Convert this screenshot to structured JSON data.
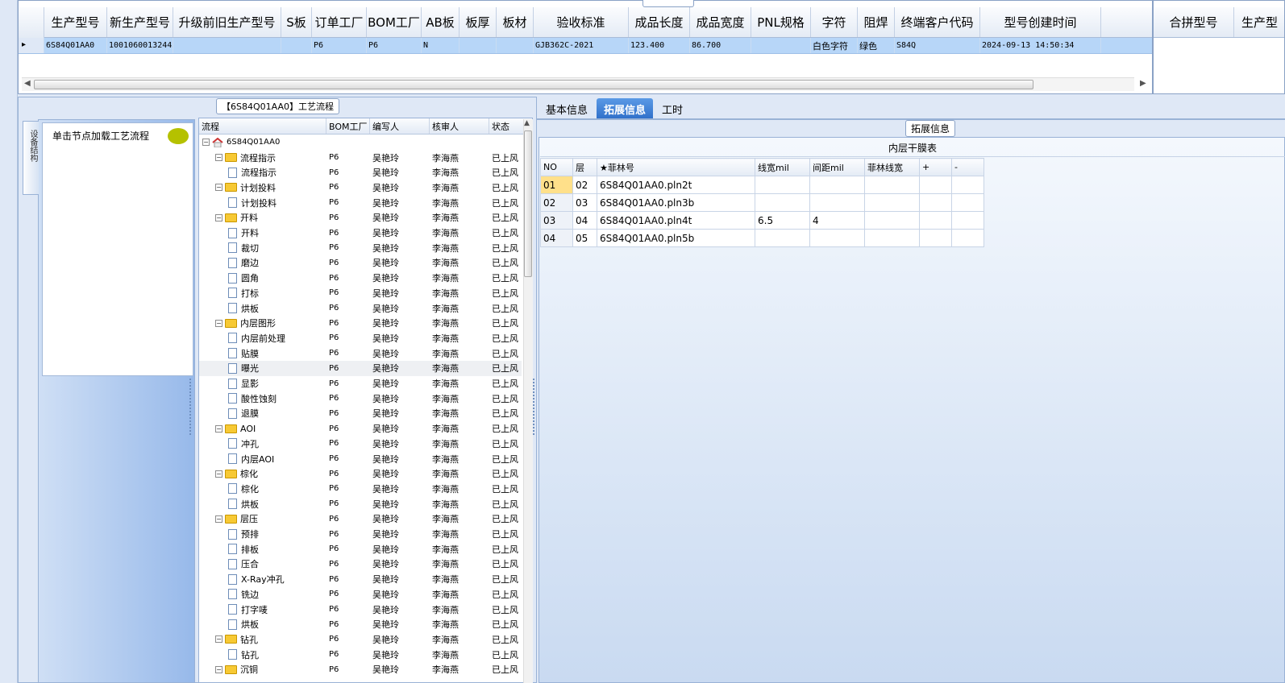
{
  "top_grid": {
    "columns": [
      "生产型号",
      "新生产型号",
      "升级前旧生产型号",
      "S板",
      "订单工厂",
      "BOM工厂",
      "AB板",
      "板厚",
      "板材",
      "验收标准",
      "成品长度",
      "成品宽度",
      "PNL规格",
      "字符",
      "阻焊",
      "终端客户代码",
      "型号创建时间"
    ],
    "row": [
      "6S84Q01AA0",
      "10010600132443",
      "",
      "",
      "P6",
      "P6",
      "N",
      "",
      "",
      "GJB362C-2021",
      "123.400",
      "86.700",
      "",
      "白色字符",
      "绿色",
      "S84Q",
      "2024-09-13 14:50:34"
    ],
    "row_marker": "▸"
  },
  "right_grid": {
    "columns": [
      "合拼型号",
      "生产型"
    ]
  },
  "left_panel": {
    "legend": "【6S84Q01AA0】工艺流程",
    "vertical_tab": "设备结构",
    "node_hint": "单击节点加载工艺流程"
  },
  "tree": {
    "headers": [
      "流程",
      "BOM工厂",
      "编写人",
      "核审人",
      "状态"
    ],
    "root": "6S84Q01AA0",
    "rows": [
      {
        "label": "流程指示",
        "level": 1,
        "folder": true,
        "bom": "P6",
        "writer": "吴艳玲",
        "checker": "李海燕",
        "status": "已上风"
      },
      {
        "label": "流程指示",
        "level": 2,
        "folder": false,
        "bom": "P6",
        "writer": "吴艳玲",
        "checker": "李海燕",
        "status": "已上风"
      },
      {
        "label": "计划投料",
        "level": 1,
        "folder": true,
        "bom": "P6",
        "writer": "吴艳玲",
        "checker": "李海燕",
        "status": "已上风"
      },
      {
        "label": "计划投料",
        "level": 2,
        "folder": false,
        "bom": "P6",
        "writer": "吴艳玲",
        "checker": "李海燕",
        "status": "已上风"
      },
      {
        "label": "开料",
        "level": 1,
        "folder": true,
        "bom": "P6",
        "writer": "吴艳玲",
        "checker": "李海燕",
        "status": "已上风"
      },
      {
        "label": "开料",
        "level": 2,
        "folder": false,
        "bom": "P6",
        "writer": "吴艳玲",
        "checker": "李海燕",
        "status": "已上风"
      },
      {
        "label": "裁切",
        "level": 2,
        "folder": false,
        "bom": "P6",
        "writer": "吴艳玲",
        "checker": "李海燕",
        "status": "已上风"
      },
      {
        "label": "磨边",
        "level": 2,
        "folder": false,
        "bom": "P6",
        "writer": "吴艳玲",
        "checker": "李海燕",
        "status": "已上风"
      },
      {
        "label": "圆角",
        "level": 2,
        "folder": false,
        "bom": "P6",
        "writer": "吴艳玲",
        "checker": "李海燕",
        "status": "已上风"
      },
      {
        "label": "打标",
        "level": 2,
        "folder": false,
        "bom": "P6",
        "writer": "吴艳玲",
        "checker": "李海燕",
        "status": "已上风"
      },
      {
        "label": "烘板",
        "level": 2,
        "folder": false,
        "bom": "P6",
        "writer": "吴艳玲",
        "checker": "李海燕",
        "status": "已上风"
      },
      {
        "label": "内层图形",
        "level": 1,
        "folder": true,
        "bom": "P6",
        "writer": "吴艳玲",
        "checker": "李海燕",
        "status": "已上风"
      },
      {
        "label": "内层前处理",
        "level": 2,
        "folder": false,
        "bom": "P6",
        "writer": "吴艳玲",
        "checker": "李海燕",
        "status": "已上风"
      },
      {
        "label": "贴膜",
        "level": 2,
        "folder": false,
        "bom": "P6",
        "writer": "吴艳玲",
        "checker": "李海燕",
        "status": "已上风"
      },
      {
        "label": "曝光",
        "level": 2,
        "folder": false,
        "bom": "P6",
        "writer": "吴艳玲",
        "checker": "李海燕",
        "status": "已上风",
        "selected": true
      },
      {
        "label": "显影",
        "level": 2,
        "folder": false,
        "bom": "P6",
        "writer": "吴艳玲",
        "checker": "李海燕",
        "status": "已上风"
      },
      {
        "label": "酸性蚀刻",
        "level": 2,
        "folder": false,
        "bom": "P6",
        "writer": "吴艳玲",
        "checker": "李海燕",
        "status": "已上风"
      },
      {
        "label": "退膜",
        "level": 2,
        "folder": false,
        "bom": "P6",
        "writer": "吴艳玲",
        "checker": "李海燕",
        "status": "已上风"
      },
      {
        "label": "AOI",
        "level": 1,
        "folder": true,
        "bom": "P6",
        "writer": "吴艳玲",
        "checker": "李海燕",
        "status": "已上风"
      },
      {
        "label": "冲孔",
        "level": 2,
        "folder": false,
        "bom": "P6",
        "writer": "吴艳玲",
        "checker": "李海燕",
        "status": "已上风"
      },
      {
        "label": "内层AOI",
        "level": 2,
        "folder": false,
        "bom": "P6",
        "writer": "吴艳玲",
        "checker": "李海燕",
        "status": "已上风"
      },
      {
        "label": "棕化",
        "level": 1,
        "folder": true,
        "bom": "P6",
        "writer": "吴艳玲",
        "checker": "李海燕",
        "status": "已上风"
      },
      {
        "label": "棕化",
        "level": 2,
        "folder": false,
        "bom": "P6",
        "writer": "吴艳玲",
        "checker": "李海燕",
        "status": "已上风"
      },
      {
        "label": "烘板",
        "level": 2,
        "folder": false,
        "bom": "P6",
        "writer": "吴艳玲",
        "checker": "李海燕",
        "status": "已上风"
      },
      {
        "label": "层压",
        "level": 1,
        "folder": true,
        "bom": "P6",
        "writer": "吴艳玲",
        "checker": "李海燕",
        "status": "已上风"
      },
      {
        "label": "预排",
        "level": 2,
        "folder": false,
        "bom": "P6",
        "writer": "吴艳玲",
        "checker": "李海燕",
        "status": "已上风"
      },
      {
        "label": "排板",
        "level": 2,
        "folder": false,
        "bom": "P6",
        "writer": "吴艳玲",
        "checker": "李海燕",
        "status": "已上风"
      },
      {
        "label": "压合",
        "level": 2,
        "folder": false,
        "bom": "P6",
        "writer": "吴艳玲",
        "checker": "李海燕",
        "status": "已上风"
      },
      {
        "label": "X-Ray冲孔",
        "level": 2,
        "folder": false,
        "bom": "P6",
        "writer": "吴艳玲",
        "checker": "李海燕",
        "status": "已上风"
      },
      {
        "label": "铣边",
        "level": 2,
        "folder": false,
        "bom": "P6",
        "writer": "吴艳玲",
        "checker": "李海燕",
        "status": "已上风"
      },
      {
        "label": "打字唛",
        "level": 2,
        "folder": false,
        "bom": "P6",
        "writer": "吴艳玲",
        "checker": "李海燕",
        "status": "已上风"
      },
      {
        "label": "烘板",
        "level": 2,
        "folder": false,
        "bom": "P6",
        "writer": "吴艳玲",
        "checker": "李海燕",
        "status": "已上风"
      },
      {
        "label": "钻孔",
        "level": 1,
        "folder": true,
        "bom": "P6",
        "writer": "吴艳玲",
        "checker": "李海燕",
        "status": "已上风"
      },
      {
        "label": "钻孔",
        "level": 2,
        "folder": false,
        "bom": "P6",
        "writer": "吴艳玲",
        "checker": "李海燕",
        "status": "已上风"
      },
      {
        "label": "沉铜",
        "level": 1,
        "folder": true,
        "bom": "P6",
        "writer": "吴艳玲",
        "checker": "李海燕",
        "status": "已上风"
      }
    ]
  },
  "right_panel": {
    "tabs": [
      "基本信息",
      "拓展信息",
      "工时"
    ],
    "active_tab": 1,
    "legend": "拓展信息",
    "table_title": "内层干膜表",
    "table_headers": [
      "NO",
      "层",
      "★菲林号",
      "线宽mil",
      "间距mil",
      "菲林线宽",
      "+",
      "-"
    ],
    "table_rows": [
      [
        "01",
        "02",
        "6S84Q01AA0.pln2t",
        "",
        "",
        "",
        "",
        ""
      ],
      [
        "02",
        "03",
        "6S84Q01AA0.pln3b",
        "",
        "",
        "",
        "",
        ""
      ],
      [
        "03",
        "04",
        "6S84Q01AA0.pln4t",
        "6.5",
        "4",
        "",
        "",
        ""
      ],
      [
        "04",
        "05",
        "6S84Q01AA0.pln5b",
        "",
        "",
        "",
        "",
        ""
      ]
    ]
  },
  "colors": {
    "selection": "#b7d6f8",
    "tab_active": "#2f6fc9",
    "folder": "#f7c934",
    "bubble": "#b5c100"
  }
}
